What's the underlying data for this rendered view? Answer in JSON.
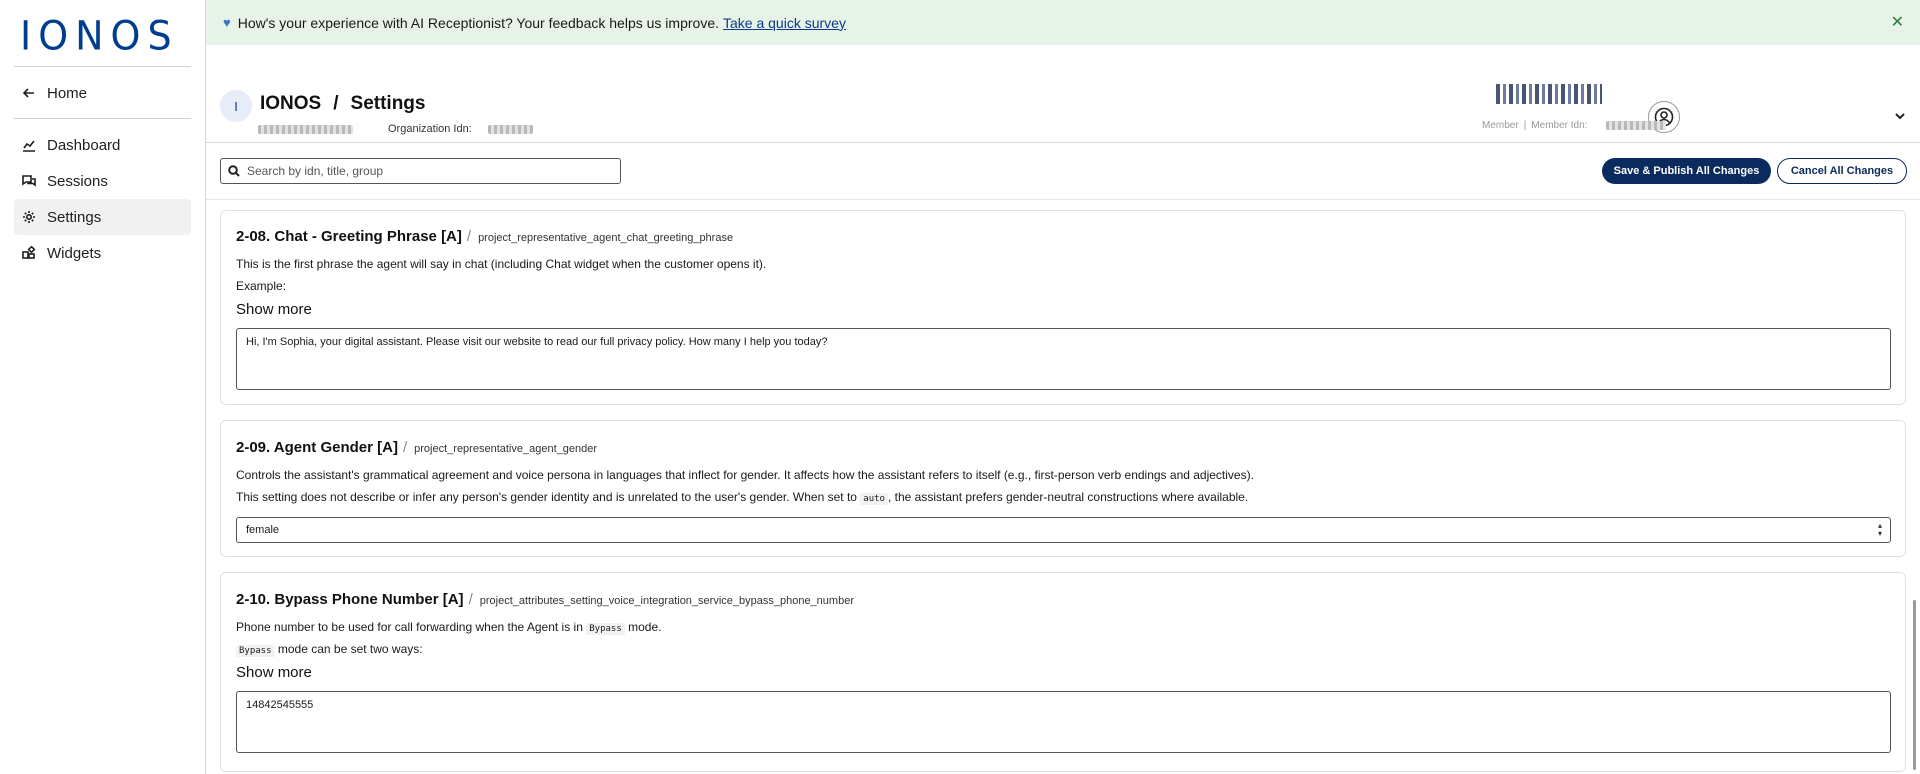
{
  "sidebar": {
    "logo": "IONOS",
    "items": [
      {
        "label": "Home",
        "icon": "arrow-left-icon"
      },
      {
        "label": "Dashboard",
        "icon": "chart-line-icon"
      },
      {
        "label": "Sessions",
        "icon": "chat-bubbles-icon"
      },
      {
        "label": "Settings",
        "icon": "gear-icon",
        "active": true
      },
      {
        "label": "Widgets",
        "icon": "widgets-icon"
      }
    ]
  },
  "banner": {
    "icon": "heart-icon",
    "text": "How's your experience with AI Receptionist? Your feedback helps us improve.",
    "link": "Take a quick survey",
    "close": "✕",
    "background": "#e6f3e6"
  },
  "header": {
    "avatar_letter": "I",
    "org": "IONOS",
    "slash": "/",
    "page": "Settings",
    "org_idn_label": "Organization Idn:",
    "member_label": "Member",
    "member_idn_label": "Member Idn:"
  },
  "toolbar": {
    "search_placeholder": "Search by idn, title, group",
    "save_label": "Save & Publish All Changes",
    "cancel_label": "Cancel All Changes",
    "accent": "#0b2a5e"
  },
  "settings": [
    {
      "title": "2-08. Chat - Greeting Phrase [A]",
      "sep": "/",
      "key": "project_representative_agent_chat_greeting_phrase",
      "line1": "This is the first phrase the agent will say in chat (including Chat widget when the customer opens it).",
      "line2": "Example:",
      "show_more": "Show more",
      "value": "Hi, I'm Sophia, your digital assistant. Please visit our website to read our full privacy policy. How many I help you today?"
    },
    {
      "title": "2-09. Agent Gender [A]",
      "sep": "/",
      "key": "project_representative_agent_gender",
      "line1": "Controls the assistant's grammatical agreement and voice persona in languages that inflect for gender. It affects how the assistant refers to itself (e.g., first-person verb endings and adjectives).",
      "line2_pre": "This setting does not describe or infer any person's gender identity and is unrelated to the user's gender. When set to",
      "line2_code": "auto",
      "line2_post": ", the assistant prefers gender-neutral constructions where available.",
      "value": "female"
    },
    {
      "title": "2-10. Bypass Phone Number [A]",
      "sep": "/",
      "key": "project_attributes_setting_voice_integration_service_bypass_phone_number",
      "line1_pre": "Phone number to be used for call forwarding when the Agent is in",
      "line1_code": "Bypass",
      "line1_post": "mode.",
      "line2_code": "Bypass",
      "line2_post": "mode can be set two ways:",
      "show_more": "Show more",
      "value": "14842545555"
    }
  ]
}
